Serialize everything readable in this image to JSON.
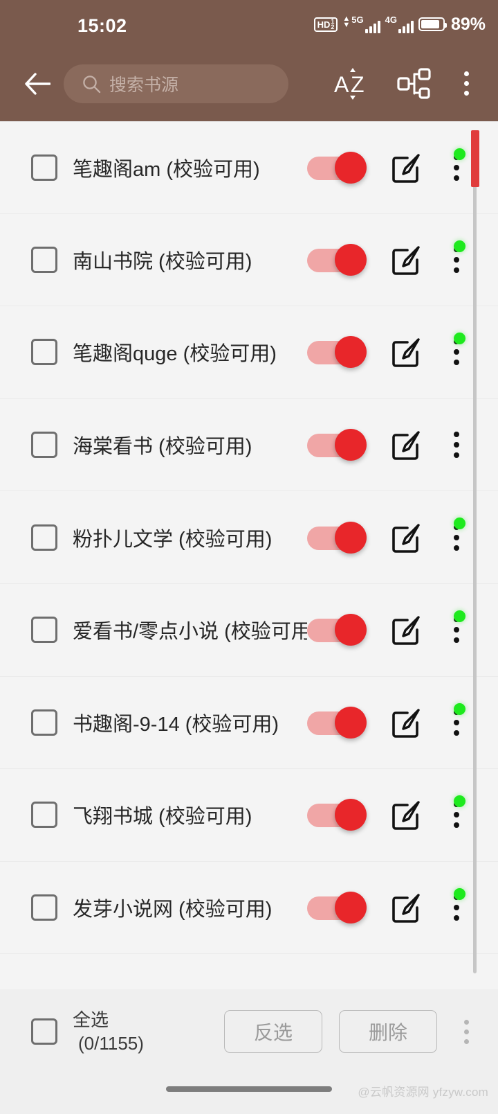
{
  "status_bar": {
    "time": "15:02",
    "hd_label": "HD",
    "hd_sup": "1",
    "hd_sub": "2",
    "sim1_network": "5G",
    "sim2_network": "4G",
    "battery_percent": "89%"
  },
  "action_bar": {
    "back_label": "返回",
    "search_placeholder": "搜索书源",
    "search_value": "",
    "sort_label": "AZ",
    "group_label": "分组",
    "overflow_label": "更多"
  },
  "theme": {
    "header_bg": "#7a5a4d",
    "search_bg": "#8a6a5c",
    "switch_on": "#e8262a",
    "switch_track": "#f0a6a6",
    "status_dot": "#1dea1d",
    "scrollbar_thumb": "#e03c3c",
    "list_bg": "#f4f4f4"
  },
  "list": {
    "rows": [
      {
        "name": "笔趣阁am (校验可用)",
        "enabled": true,
        "has_status_dot": true
      },
      {
        "name": "南山书院 (校验可用)",
        "enabled": true,
        "has_status_dot": true
      },
      {
        "name": "笔趣阁quge (校验可用)",
        "enabled": true,
        "has_status_dot": true
      },
      {
        "name": "海棠看书 (校验可用)",
        "enabled": true,
        "has_status_dot": false
      },
      {
        "name": "粉扑儿文学 (校验可用)",
        "enabled": true,
        "has_status_dot": true
      },
      {
        "name": "爱看书/零点小说 (校验可用)",
        "enabled": true,
        "has_status_dot": true
      },
      {
        "name": "书趣阁-9-14 (校验可用)",
        "enabled": true,
        "has_status_dot": true
      },
      {
        "name": "飞翔书城 (校验可用)",
        "enabled": true,
        "has_status_dot": true
      },
      {
        "name": "发芽小说网 (校验可用)",
        "enabled": true,
        "has_status_dot": true
      }
    ]
  },
  "bottom_bar": {
    "select_all_label": "全选",
    "select_count": "(0/1155)",
    "invert_label": "反选",
    "delete_label": "删除",
    "overflow_label": "更多"
  },
  "watermark": "@云帆资源网 yfzyw.com"
}
